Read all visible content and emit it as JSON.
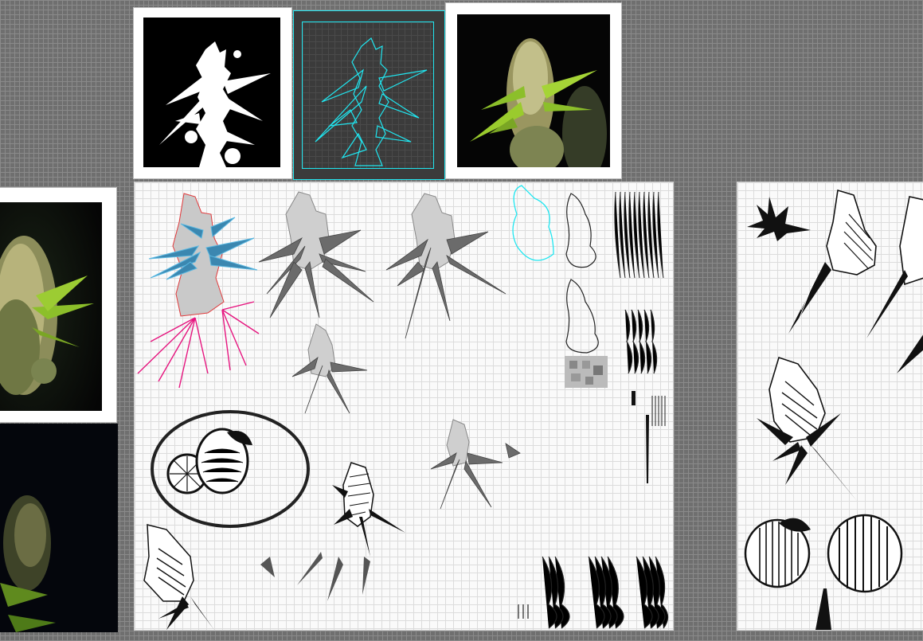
{
  "canvas": {
    "background": "#6f6f6f",
    "grid_color": "#8a8a8a"
  },
  "artboards": [
    {
      "name": "threshold-mask-artboard",
      "background": "#000000",
      "foreground": "#ffffff"
    },
    {
      "name": "outline-trace-artboard",
      "background": "#3b3b3b",
      "stroke": "#20e6f0",
      "selected": true
    },
    {
      "name": "color-photo-artboard",
      "background": "#050505"
    }
  ],
  "work_sheets": [
    {
      "name": "main-drawing-sheet",
      "contents": [
        "cannabis-bud-illustrations",
        "lemon-logo",
        "contour-outlines",
        "line-hatch-swatches",
        "ink-stroke-brushes"
      ]
    },
    {
      "name": "right-drawing-sheet",
      "contents": [
        "hatched-bud-drawings",
        "peach-illustration",
        "leaf-icon"
      ]
    }
  ],
  "colors": {
    "selection_cyan": "#20e6f0",
    "leaf_blue": "#3b87b0",
    "leaf_magenta": "#e6157f",
    "outline_red": "#e0393b",
    "bud_gray": "#c9c9c9",
    "leaf_gray": "#6b6b6b",
    "ink": "#111111",
    "leaf_green": "#8cbf2a"
  }
}
